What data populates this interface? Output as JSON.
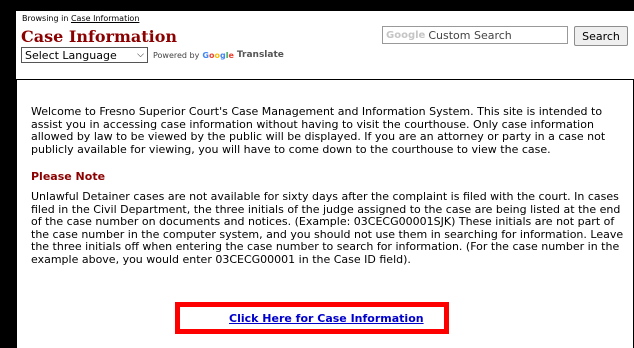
{
  "header": {
    "breadcrumb_prefix": "Browsing in",
    "breadcrumb_link": "Case Information",
    "title": "Case Information",
    "language_select": "Select Language",
    "powered_by": "Powered by",
    "google_logo": "Google",
    "translate_label": "Translate",
    "search_brand": "Google",
    "search_placeholder": "Custom Search",
    "search_button": "Search"
  },
  "main": {
    "intro": "Welcome to Fresno Superior Court's Case Management and Information System. This site is intended to assist you in accessing case information without having to visit the courthouse. Only case information allowed by law to be viewed by the public will be displayed. If you are an attorney or party in a case not publicly available for viewing, you will have to come down to the courthouse to view the case.",
    "note_heading": "Please Note",
    "note_body": "Unlawful Detainer cases are not available for sixty days after the complaint is filed with the court. In cases filed in the Civil Department, the three initials of the judge assigned to the case are being listed at the end of the case number on documents and notices. (Example: 03CECG00001SJK) These initials are not part of the case number in the computer system, and you should not use them in searching for information. Leave the three initials off when entering the case number to search for information. (For the case number in the example above, you would enter 03CECG00001 in the Case ID field).",
    "cta_link": "Click Here for Case Information"
  },
  "colors": {
    "title": "#8b0000",
    "link": "#0000cc",
    "highlight_frame": "#ff0000",
    "background": "#000000"
  }
}
